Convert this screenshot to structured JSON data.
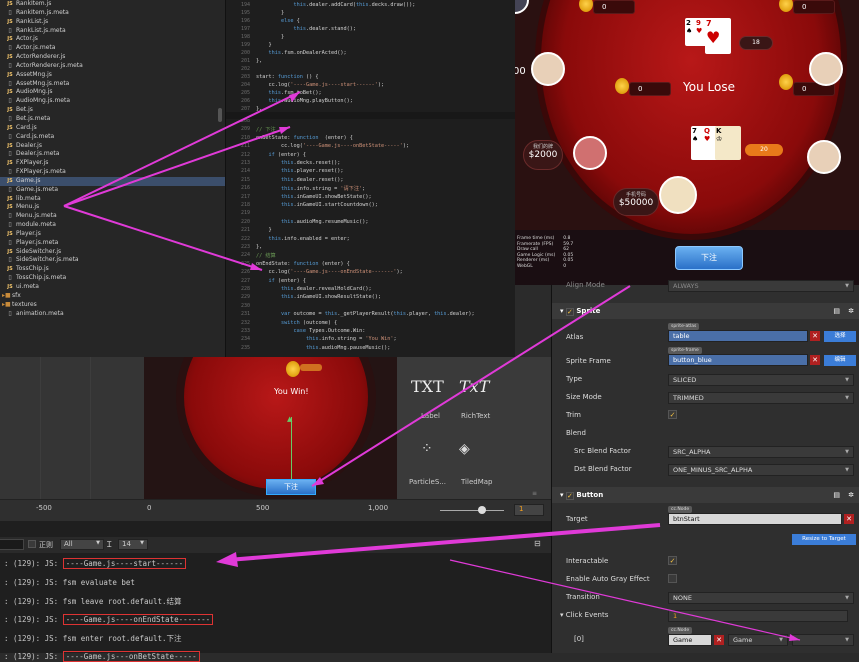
{
  "file_tree": [
    {
      "icon": "js",
      "label": "RankItem.js"
    },
    {
      "icon": "doc",
      "label": "RankItem.js.meta"
    },
    {
      "icon": "js",
      "label": "RankList.js"
    },
    {
      "icon": "doc",
      "label": "RankList.js.meta"
    },
    {
      "icon": "js",
      "label": "Actor.js"
    },
    {
      "icon": "doc",
      "label": "Actor.js.meta"
    },
    {
      "icon": "js",
      "label": "ActorRenderer.js"
    },
    {
      "icon": "doc",
      "label": "ActorRenderer.js.meta"
    },
    {
      "icon": "js",
      "label": "AssetMng.js"
    },
    {
      "icon": "doc",
      "label": "AssetMng.js.meta"
    },
    {
      "icon": "js",
      "label": "AudioMng.js"
    },
    {
      "icon": "doc",
      "label": "AudioMng.js.meta"
    },
    {
      "icon": "js",
      "label": "Bet.js"
    },
    {
      "icon": "doc",
      "label": "Bet.js.meta"
    },
    {
      "icon": "js",
      "label": "Card.js"
    },
    {
      "icon": "doc",
      "label": "Card.js.meta"
    },
    {
      "icon": "js",
      "label": "Dealer.js"
    },
    {
      "icon": "doc",
      "label": "Dealer.js.meta"
    },
    {
      "icon": "js",
      "label": "FXPlayer.js"
    },
    {
      "icon": "doc",
      "label": "FXPlayer.js.meta"
    },
    {
      "icon": "js",
      "label": "Game.js"
    },
    {
      "icon": "doc",
      "label": "Game.js.meta"
    },
    {
      "icon": "js",
      "label": "lib.meta"
    },
    {
      "icon": "js",
      "label": "Menu.js"
    },
    {
      "icon": "doc",
      "label": "Menu.js.meta"
    },
    {
      "icon": "doc",
      "label": "module.meta"
    },
    {
      "icon": "js",
      "label": "Player.js"
    },
    {
      "icon": "doc",
      "label": "Player.js.meta"
    },
    {
      "icon": "js",
      "label": "SideSwitcher.js"
    },
    {
      "icon": "doc",
      "label": "SideSwitcher.js.meta"
    },
    {
      "icon": "js",
      "label": "TossChip.js"
    },
    {
      "icon": "doc",
      "label": "TossChip.js.meta"
    },
    {
      "icon": "js",
      "label": "ui.meta"
    },
    {
      "icon": "fold",
      "label": "sfx"
    },
    {
      "icon": "fold",
      "label": "textures"
    },
    {
      "icon": "doc",
      "label": "animation.meta"
    }
  ],
  "code_top": [
    {
      "n": "194",
      "t": "            this.dealer.addCard(this.decks.draw());"
    },
    {
      "n": "195",
      "t": "        }"
    },
    {
      "n": "196",
      "t": "        else {"
    },
    {
      "n": "197",
      "t": "            this.dealer.stand();"
    },
    {
      "n": "198",
      "t": "        }"
    },
    {
      "n": "199",
      "t": "    }"
    },
    {
      "n": "200",
      "t": "    this.fsm.onDealerActed();"
    },
    {
      "n": "201",
      "t": "},"
    },
    {
      "n": "202",
      "t": ""
    },
    {
      "n": "203",
      "t": "start: function () {"
    },
    {
      "n": "204",
      "t": "    cc.log('----Game.js----start------');"
    },
    {
      "n": "205",
      "t": "    this.fsm.toBet();"
    },
    {
      "n": "206",
      "t": "    this.audioMng.playButton();"
    },
    {
      "n": "207",
      "t": "},"
    }
  ],
  "code_bottom": [
    {
      "n": "208",
      "t": ""
    },
    {
      "n": "209",
      "t": "// 下注"
    },
    {
      "n": "210",
      "t": "onBetState: function  (enter) {"
    },
    {
      "n": "211",
      "t": "        cc.log('----Game.js----onBetState-----');"
    },
    {
      "n": "212",
      "t": "    if (enter) {"
    },
    {
      "n": "213",
      "t": "        this.decks.reset();"
    },
    {
      "n": "214",
      "t": "        this.player.reset();"
    },
    {
      "n": "215",
      "t": "        this.dealer.reset();"
    },
    {
      "n": "216",
      "t": "        this.info.string = '请下注';"
    },
    {
      "n": "217",
      "t": "        this.inGameUI.showBetState();"
    },
    {
      "n": "218",
      "t": "        this.inGameUI.startCountdown();"
    },
    {
      "n": "219",
      "t": ""
    },
    {
      "n": "220",
      "t": "        this.audioMng.resumeMusic();"
    },
    {
      "n": "221",
      "t": "    }"
    },
    {
      "n": "222",
      "t": "    this.info.enabled = enter;"
    },
    {
      "n": "223",
      "t": "},"
    },
    {
      "n": "224",
      "t": "// 结算"
    },
    {
      "n": "225",
      "t": "onEndState: function (enter) {"
    },
    {
      "n": "226",
      "t": "    cc.log('----Game.js----onEndState-------');"
    },
    {
      "n": "227",
      "t": "    if (enter) {"
    },
    {
      "n": "228",
      "t": "        this.dealer.revealHoldCard();"
    },
    {
      "n": "229",
      "t": "        this.inGameUI.showResultState();"
    },
    {
      "n": "230",
      "t": ""
    },
    {
      "n": "231",
      "t": "        var outcome = this._getPlayerResult(this.player, this.dealer);"
    },
    {
      "n": "232",
      "t": "        switch (outcome) {"
    },
    {
      "n": "233",
      "t": "            case Types.Outcome.Win:"
    },
    {
      "n": "234",
      "t": "                this.info.string = 'You Win';"
    },
    {
      "n": "235",
      "t": "                this.audioMng.pauseMusic();"
    }
  ],
  "game": {
    "chip_values": [
      "0",
      "0",
      "0",
      "0"
    ],
    "result_text": "You Lose",
    "dealer_score": "18",
    "player_score": "20",
    "left_cash": "$2000",
    "bottom_cash": "$50000",
    "left_label": "我们的牌",
    "bottom_label": "手机号码",
    "btn_label": "下注",
    "dealer_cards": [
      "2",
      "9",
      "7"
    ],
    "player_cards": [
      "7",
      "Q",
      "K"
    ],
    "stats": [
      "Frame time (ms)",
      "Framerate (FPS)",
      "Draw call",
      "Game Logic (ms)",
      "Renderer (ms)",
      "WebGL"
    ],
    "stat_vals": [
      "0.8",
      "59.7",
      "62",
      "0.05",
      "0.05",
      "0"
    ]
  },
  "inspector": {
    "align_mode_label": "Align Mode",
    "align_mode_value": "ALWAYS",
    "sprite_header": "Sprite",
    "atlas_label": "Atlas",
    "atlas_tag": "sprite-atlas",
    "atlas_value": "table",
    "atlas_btn": "选择",
    "frame_label": "Sprite Frame",
    "frame_tag": "sprite-frame",
    "frame_value": "button_blue",
    "frame_btn": "编辑",
    "type_label": "Type",
    "type_value": "SLICED",
    "size_label": "Size Mode",
    "size_value": "TRIMMED",
    "trim_label": "Trim",
    "blend_label": "Blend",
    "src_label": "Src Blend Factor",
    "src_value": "SRC_ALPHA",
    "dst_label": "Dst Blend Factor",
    "dst_value": "ONE_MINUS_SRC_ALPHA",
    "button_header": "Button",
    "target_label": "Target",
    "target_tag": "cc.Node",
    "target_value": "btnStart",
    "resize_btn": "Resize to Target",
    "interactable_label": "Interactable",
    "auto_gray_label": "Enable Auto Gray Effect",
    "transition_label": "Transition",
    "transition_value": "NONE",
    "click_events_label": "Click Events",
    "click_events_count": "1",
    "event_index": "[0]",
    "event_tag": "cc.Node",
    "event_node": "Game",
    "event_component": "Game"
  },
  "scene": {
    "win_text": "You Win!",
    "btn_label": "下注",
    "ruler_ticks": [
      "-500",
      "0",
      "500",
      "1,000"
    ],
    "zoom_value": "1"
  },
  "widgets": [
    {
      "label": "Label",
      "glyph": "TXT"
    },
    {
      "label": "RichText",
      "glyph": "TxT"
    },
    {
      "label": "ParticleS...",
      "glyph": "particle"
    },
    {
      "label": "TiledMap",
      "glyph": "tiled"
    }
  ],
  "console_toolbar": {
    "regex_label": "正则",
    "filter_value": "All",
    "font_size": "14"
  },
  "console_lines": [
    {
      "prefix": ": (129): JS: ",
      "msg": "----Game.js----start------",
      "hl": true
    },
    {
      "prefix": ": (129): JS: ",
      "msg": "fsm evaluate bet",
      "hl": false
    },
    {
      "prefix": ": (129): JS: ",
      "msg": "fsm leave root.default.结算",
      "hl": false
    },
    {
      "prefix": ": (129): JS: ",
      "msg": "----Game.js----onEndState-------",
      "hl": true
    },
    {
      "prefix": ": (129): JS: ",
      "msg": "fsm enter root.default.下注",
      "hl": false
    },
    {
      "prefix": ": (129): JS: ",
      "msg": "----Game.js---onBetState-----",
      "hl": true
    }
  ],
  "colors": {
    "arrow": "#e03ad8",
    "felt_red": "#a01010",
    "selection": "#3b4e6b",
    "highlight_border": "#d33"
  }
}
